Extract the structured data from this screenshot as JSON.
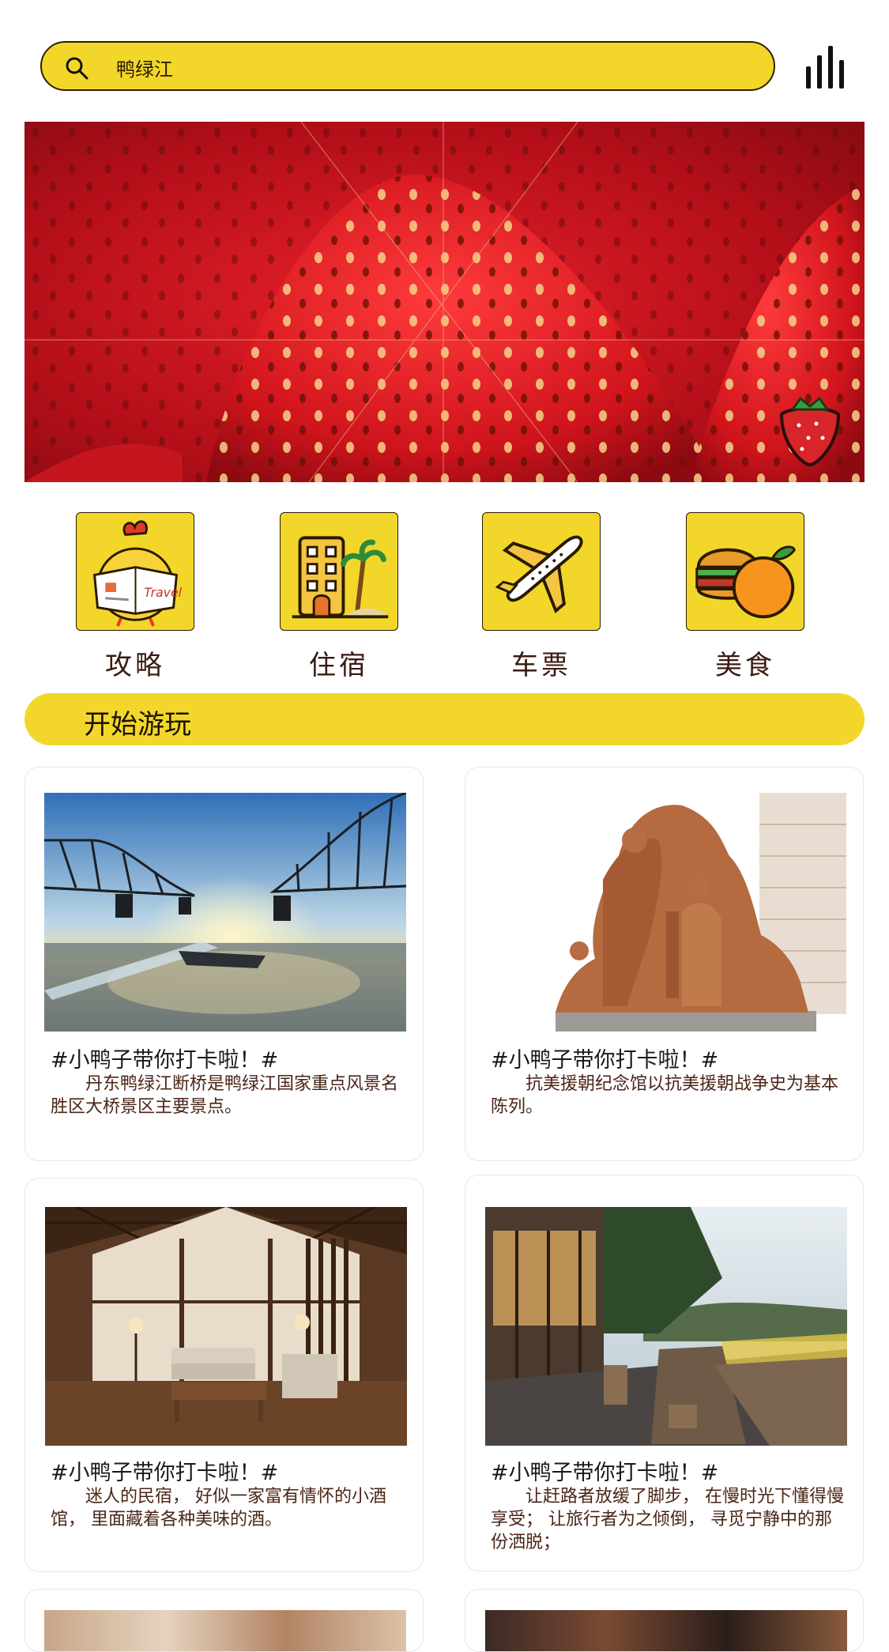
{
  "search": {
    "value": "鸭绿江",
    "icon": "search-icon"
  },
  "menu": {
    "icon": "bar-chart-menu-icon"
  },
  "banner": {
    "subject": "strawberry",
    "badge_icon": "strawberry-icon"
  },
  "categories": [
    {
      "label": "攻略",
      "icon": "chick-newspaper-icon"
    },
    {
      "label": "住宿",
      "icon": "hotel-building-icon"
    },
    {
      "label": "车票",
      "icon": "airplane-icon"
    },
    {
      "label": "美食",
      "icon": "burger-orange-icon"
    }
  ],
  "section": {
    "title": "开始游玩"
  },
  "cards": [
    {
      "title": "#小鸭子带你打卡啦！#",
      "desc": "丹东鸭绿江断桥是鸭绿江国家重点风景名胜区大桥景区主要景点。",
      "photo": "bridge-photo"
    },
    {
      "title": "#小鸭子带你打卡啦！#",
      "desc": "抗美援朝纪念馆以抗美援朝战争史为基本陈列。",
      "photo": "statue-photo"
    },
    {
      "title": "#小鸭子带你打卡啦！#",
      "desc": "迷人的民宿， 好似一家富有情怀的小酒馆， 里面藏着各种美味的酒。",
      "photo": "guesthouse-interior-photo"
    },
    {
      "title": "#小鸭子带你打卡啦！#",
      "desc": "让赶路者放缓了脚步， 在慢时光下懂得慢享受； 让旅行者为之倾倒， 寻觅宁静中的那份洒脱；",
      "photo": "terrace-photo"
    }
  ],
  "colors": {
    "accent": "#F2D72A",
    "text_brown": "#3b1a12"
  }
}
